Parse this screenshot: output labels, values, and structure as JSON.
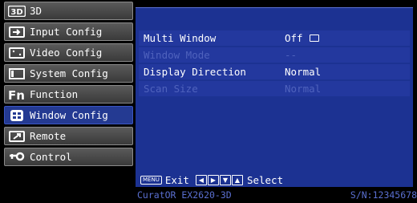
{
  "sidebar": {
    "items": [
      {
        "label": "3D",
        "icon": "3d-icon"
      },
      {
        "label": "Input Config",
        "icon": "input-icon"
      },
      {
        "label": "Video Config",
        "icon": "video-icon"
      },
      {
        "label": "System Config",
        "icon": "system-icon"
      },
      {
        "label": "Function",
        "icon": "function-icon"
      },
      {
        "label": "Window Config",
        "icon": "window-icon",
        "active": true
      },
      {
        "label": "Remote",
        "icon": "remote-icon"
      },
      {
        "label": "Control",
        "icon": "control-icon"
      }
    ]
  },
  "panel": {
    "rows": [
      {
        "name": "Multi Window",
        "value": "Off",
        "enabled": true
      },
      {
        "name": "Window Mode",
        "value": "--",
        "enabled": false
      },
      {
        "name": "Display Direction",
        "value": "Normal",
        "enabled": true
      },
      {
        "name": "Scan Size",
        "value": "Normal",
        "enabled": false
      }
    ],
    "hint": {
      "menu_key": "MENU",
      "exit_label": "Exit",
      "select_label": "Select"
    }
  },
  "footer": {
    "model": "CuratOR EX2620-3D",
    "serial": "S/N:12345678"
  },
  "colors": {
    "panel_bg": "#1c3292",
    "active_item": "#243a92",
    "disabled_text": "#4f62bd"
  }
}
